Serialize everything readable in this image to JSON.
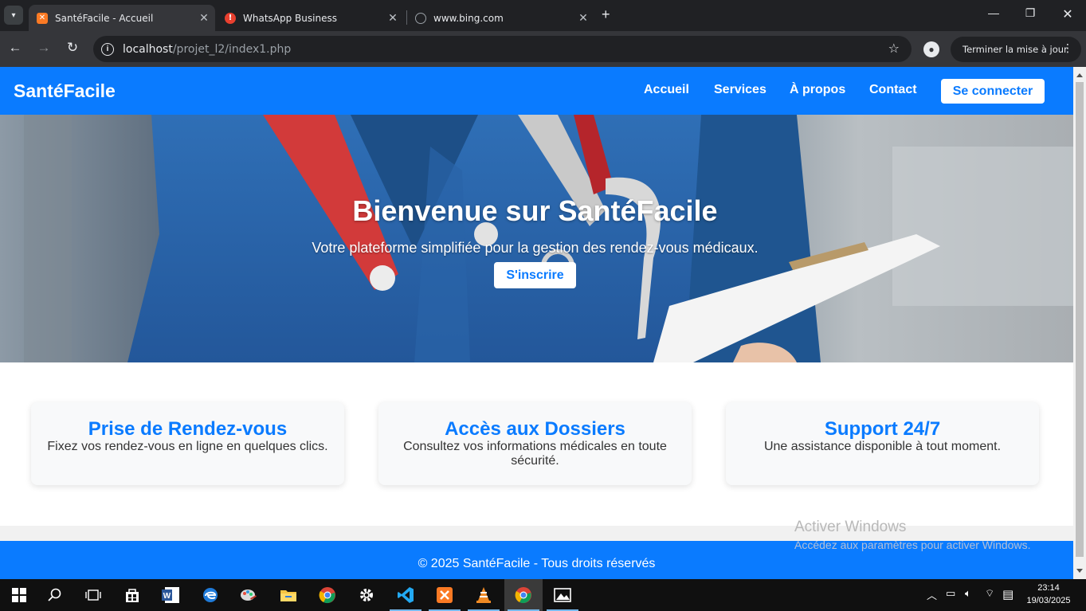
{
  "browser": {
    "tabs": [
      {
        "title": "SantéFacile - Accueil",
        "favicon": "xampp-icon",
        "color": "#fb7a24"
      },
      {
        "title": "WhatsApp Business",
        "favicon": "warning-icon",
        "color": "#e8402f"
      },
      {
        "title": "www.bing.com",
        "favicon": "globe-icon",
        "color": "#9aa0a6"
      }
    ],
    "url_host": "localhost",
    "url_path": "/projet_l2/index1.php",
    "update_button": "Terminer la mise à jour"
  },
  "site": {
    "brand": "SantéFacile",
    "nav": {
      "home": "Accueil",
      "services": "Services",
      "about": "À propos",
      "contact": "Contact",
      "login": "Se connecter"
    },
    "hero": {
      "title": "Bienvenue sur SantéFacile",
      "subtitle": "Votre plateforme simplifiée pour la gestion des rendez-vous médicaux.",
      "cta": "S'inscrire"
    },
    "features": [
      {
        "title": "Prise de Rendez-vous",
        "text": "Fixez vos rendez-vous en ligne en quelques clics."
      },
      {
        "title": "Accès aux Dossiers",
        "text": "Consultez vos informations médicales en toute sécurité."
      },
      {
        "title": "Support 24/7",
        "text": "Une assistance disponible à tout moment."
      }
    ],
    "footer": "© 2025 SantéFacile - Tous droits réservés",
    "accent": "#0a7bff"
  },
  "windows": {
    "watermark_title": "Activer Windows",
    "watermark_text": "Accédez aux paramètres pour activer Windows.",
    "clock_time": "23:14",
    "clock_date": "19/03/2025"
  }
}
